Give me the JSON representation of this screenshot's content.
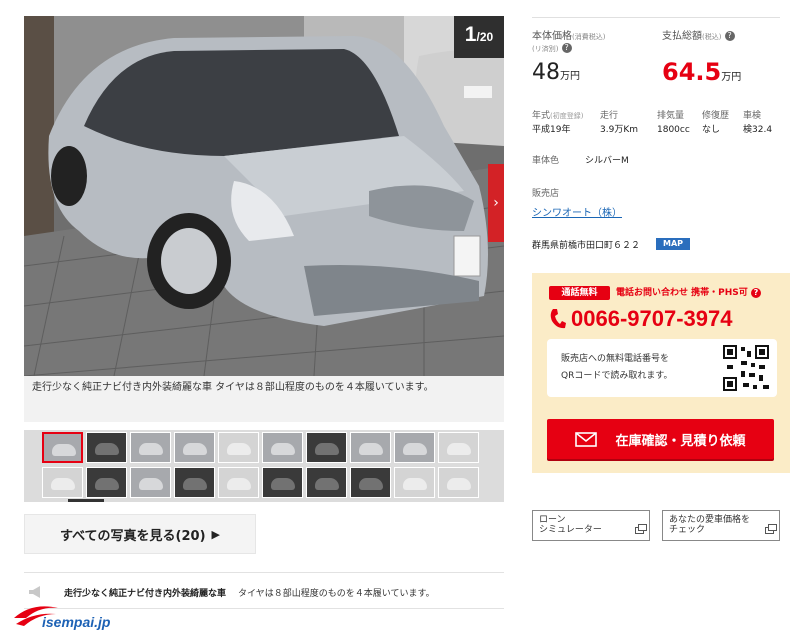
{
  "gallery": {
    "counter_current": "1",
    "counter_separator": "/",
    "counter_total": "20",
    "caption": "走行少なく純正ナビ付き内外装綺麗な車 タイヤは８部山程度のものを４本履いています。",
    "all_photos_label": "すべての写真を見る(20)",
    "thumbnails": 20
  },
  "comment": {
    "title": "走行少なく純正ナビ付き内外装綺麗な車",
    "text": "タイヤは８部山程度のものを４本履いています。"
  },
  "logo_text": "isempai.jp",
  "price": {
    "body_label": "本体価格",
    "body_label_note": "(消費税込)",
    "body_label_sub": "(リ済別)",
    "body_value": "48",
    "total_label": "支払総額",
    "total_label_note": "(税込)",
    "total_value": "64.5",
    "unit": "万円"
  },
  "specs": [
    {
      "key": "年式",
      "key_note": "(初度登録)",
      "value": "平成19年"
    },
    {
      "key": "走行",
      "key_note": "",
      "value": "3.9万Km"
    },
    {
      "key": "排気量",
      "key_note": "",
      "value": "1800cc"
    },
    {
      "key": "修復歴",
      "key_note": "",
      "value": "なし"
    },
    {
      "key": "車検",
      "key_note": "",
      "value": "検32.4"
    }
  ],
  "color": {
    "key": "車体色",
    "value": "シルバーM"
  },
  "dealer": {
    "label": "販売店",
    "name": "シンワオート（株）",
    "address": "群馬県前橋市田口町６２２",
    "map_label": "MAP"
  },
  "contact": {
    "free_badge": "通話無料",
    "free_note": "電話お問い合わせ 携帯・PHS可",
    "phone": "0066-9707-3974",
    "qr_line1": "販売店への無料電話番号を",
    "qr_line2": "QRコードで読み取れます。",
    "cta_label": "在庫確認・見積り依頼"
  },
  "buttons": {
    "loan_line1": "ローン",
    "loan_line2": "シミュレーター",
    "appraise_line1": "あなたの愛車価格を",
    "appraise_line2": "チェック"
  },
  "colors": {
    "accent": "#e60012",
    "link": "#1a66b5",
    "panel": "#fbecc7",
    "map": "#2a6ebd"
  }
}
